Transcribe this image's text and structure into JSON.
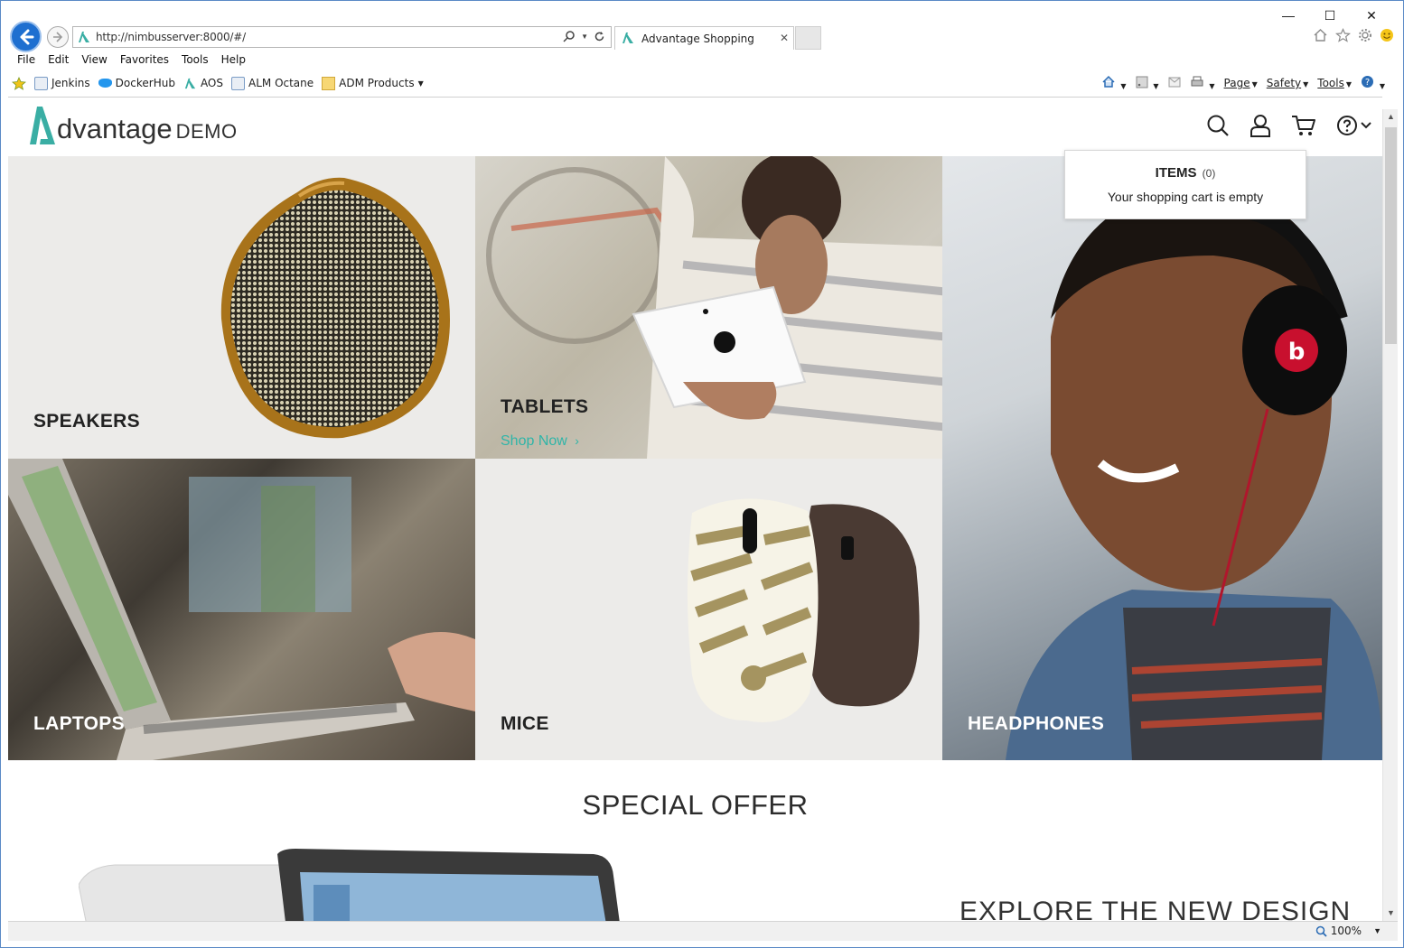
{
  "browser": {
    "url": "http://nimbusserver:8000/#/",
    "tab_title": "Advantage Shopping",
    "tab_close": "✕",
    "window_controls": [
      "—",
      "☐",
      "✕"
    ]
  },
  "menu": [
    "File",
    "Edit",
    "View",
    "Favorites",
    "Tools",
    "Help"
  ],
  "favorites": [
    "Jenkins",
    "DockerHub",
    "AOS",
    "ALM Octane",
    "ADM Products"
  ],
  "command_bar": [
    "Page",
    "Safety",
    "Tools"
  ],
  "site": {
    "logo_word": "dvantage",
    "logo_demo": "DEMO"
  },
  "tiles": {
    "speakers": "SPEAKERS",
    "tablets": "TABLETS",
    "shop_now": "Shop Now",
    "laptops": "LAPTOPS",
    "mice": "MICE",
    "headphones": "HEADPHONES"
  },
  "cart": {
    "items_label": "ITEMS",
    "count": "(0)",
    "message": "Your shopping cart is empty"
  },
  "sections": {
    "special_offer": "SPECIAL OFFER",
    "explore": "EXPLORE THE NEW DESIGN"
  },
  "status": {
    "zoom": "100%"
  },
  "colors": {
    "accent": "#2fb5a8",
    "back_button": "#1e6fd0",
    "heading": "#222222"
  }
}
